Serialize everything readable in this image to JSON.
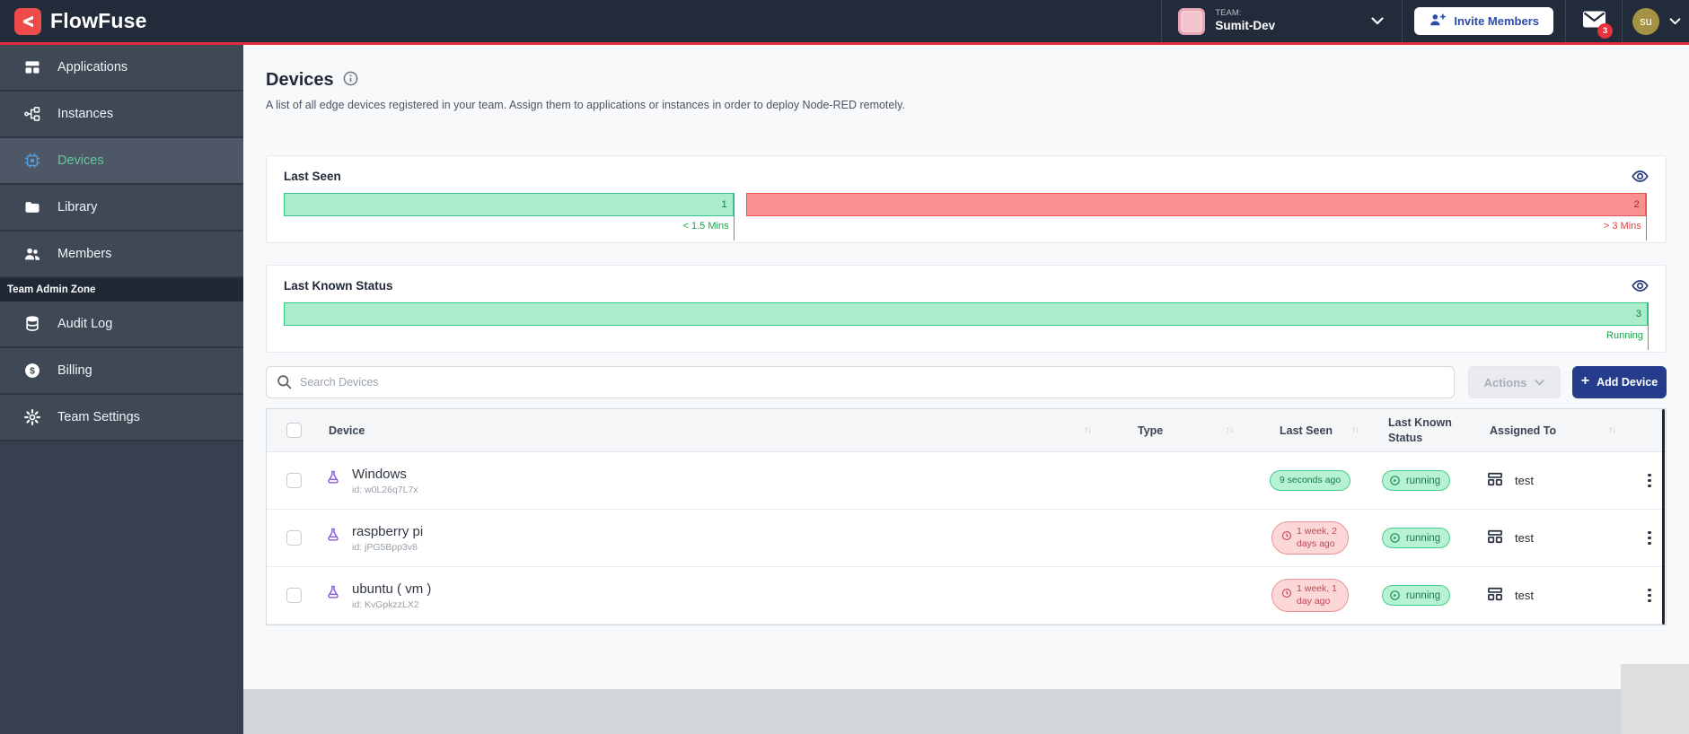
{
  "navbar": {
    "brand": "FlowFuse",
    "team_label": "TEAM:",
    "team_name": "Sumit-Dev",
    "invite_button": "Invite Members",
    "notification_count": "3",
    "avatar_initials": "su"
  },
  "sidebar": {
    "items": [
      {
        "label": "Applications"
      },
      {
        "label": "Instances"
      },
      {
        "label": "Devices"
      },
      {
        "label": "Library"
      },
      {
        "label": "Members"
      }
    ],
    "admin_zone_label": "Team Admin Zone",
    "admin_items": [
      {
        "label": "Audit Log"
      },
      {
        "label": "Billing"
      },
      {
        "label": "Team Settings"
      }
    ]
  },
  "page": {
    "title": "Devices",
    "description": "A list of all edge devices registered in your team. Assign them to applications or instances in order to deploy Node-RED remotely."
  },
  "charts": {
    "last_seen": {
      "type": "bar",
      "title": "Last Seen",
      "segments": [
        {
          "count": "1",
          "label": "< 1.5 Mins",
          "variant": "green",
          "width_pct": 33
        },
        {
          "count": "2",
          "label": "> 3 Mins",
          "variant": "red",
          "width_pct": 66
        }
      ]
    },
    "last_known_status": {
      "type": "bar",
      "title": "Last Known Status",
      "segments": [
        {
          "count": "3",
          "label": "Running",
          "variant": "green",
          "width_pct": 100
        }
      ]
    }
  },
  "toolbar": {
    "search_placeholder": "Search Devices",
    "actions_label": "Actions",
    "add_device_label": "Add Device"
  },
  "table": {
    "columns": [
      "Device",
      "Type",
      "Last Seen",
      "Last Known Status",
      "Assigned To"
    ],
    "rows": [
      {
        "name": "Windows",
        "id": "id: w0L26q7L7x",
        "last_seen": "9 seconds ago",
        "last_seen_variant": "green",
        "status": "running",
        "assigned_to": "test"
      },
      {
        "name": "raspberry pi",
        "id": "id: jPG5Bpp3v8",
        "last_seen": "1 week, 2 days ago",
        "last_seen_variant": "red",
        "status": "running",
        "assigned_to": "test"
      },
      {
        "name": "ubuntu ( vm )",
        "id": "id: KvGpkzzLX2",
        "last_seen": "1 week, 1 day ago",
        "last_seen_variant": "red",
        "status": "running",
        "assigned_to": "test"
      }
    ]
  },
  "colors": {
    "accent_red": "#e0283e",
    "navbar_navy": "#222b3a",
    "primary_button_blue": "#253c8d",
    "status_green": "#36c88b",
    "status_red": "#e85454",
    "device_icon_purple": "#8a57de"
  }
}
